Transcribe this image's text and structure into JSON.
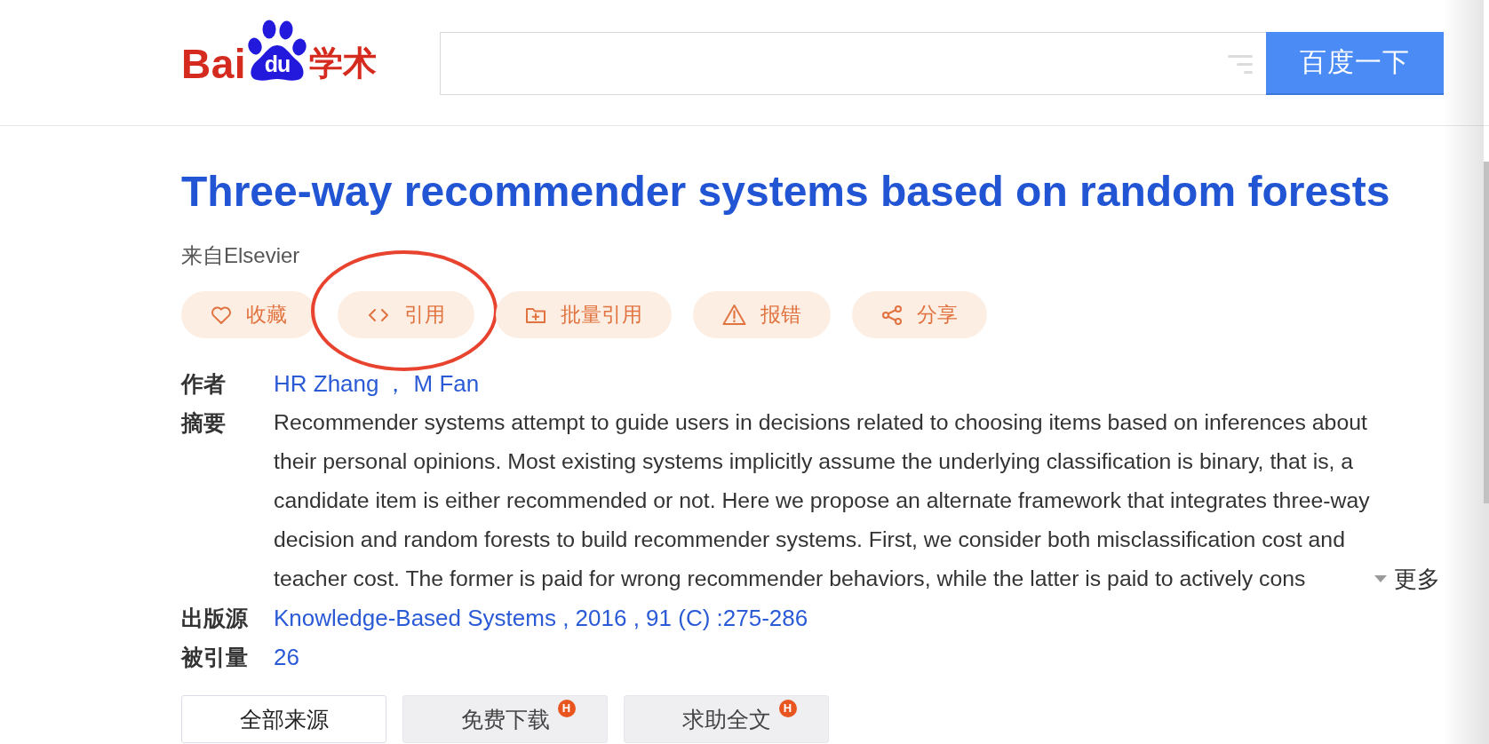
{
  "header": {
    "logo": {
      "left": "Bai",
      "paw": "du",
      "right": "学术"
    },
    "search": {
      "button": "百度一下"
    }
  },
  "paper": {
    "title": "Three-way recommender systems based on random forests",
    "source": "来自Elsevier",
    "actions": [
      {
        "kind": "favorite",
        "label": "收藏",
        "circled": false
      },
      {
        "kind": "cite",
        "label": "引用",
        "circled": true
      },
      {
        "kind": "batch",
        "label": "批量引用",
        "circled": false
      },
      {
        "kind": "report",
        "label": "报错",
        "circled": false
      },
      {
        "kind": "share",
        "label": "分享",
        "circled": false
      }
    ],
    "fields": [
      {
        "kind": "authors",
        "label": "作者",
        "values": [
          "HR Zhang",
          "M Fan"
        ],
        "separator": "，"
      },
      {
        "kind": "abstract",
        "label": "摘要",
        "value": "Recommender systems attempt to guide users in decisions related to choosing items based on inferences about their personal opinions. Most existing systems implicitly assume the underlying classification is binary, that is, a candidate item is either recommended or not. Here we propose an alternate framework that integrates three-way decision and random forests to build recommender systems. First, we consider both misclassification cost and teacher cost. The former is paid for wrong recommender behaviors, while the latter is paid to actively cons",
        "more": "更多"
      },
      {
        "kind": "link",
        "label": "出版源",
        "value": "Knowledge-Based Systems , 2016 , 91 (C) :275-286"
      },
      {
        "kind": "link",
        "label": "被引量",
        "value": "26"
      }
    ]
  },
  "source_tabs": [
    {
      "label": "全部来源",
      "selected": true
    },
    {
      "label": "免费下载",
      "selected": false,
      "badge": "H"
    },
    {
      "label": "求助全文",
      "selected": false,
      "badge": "H"
    }
  ]
}
